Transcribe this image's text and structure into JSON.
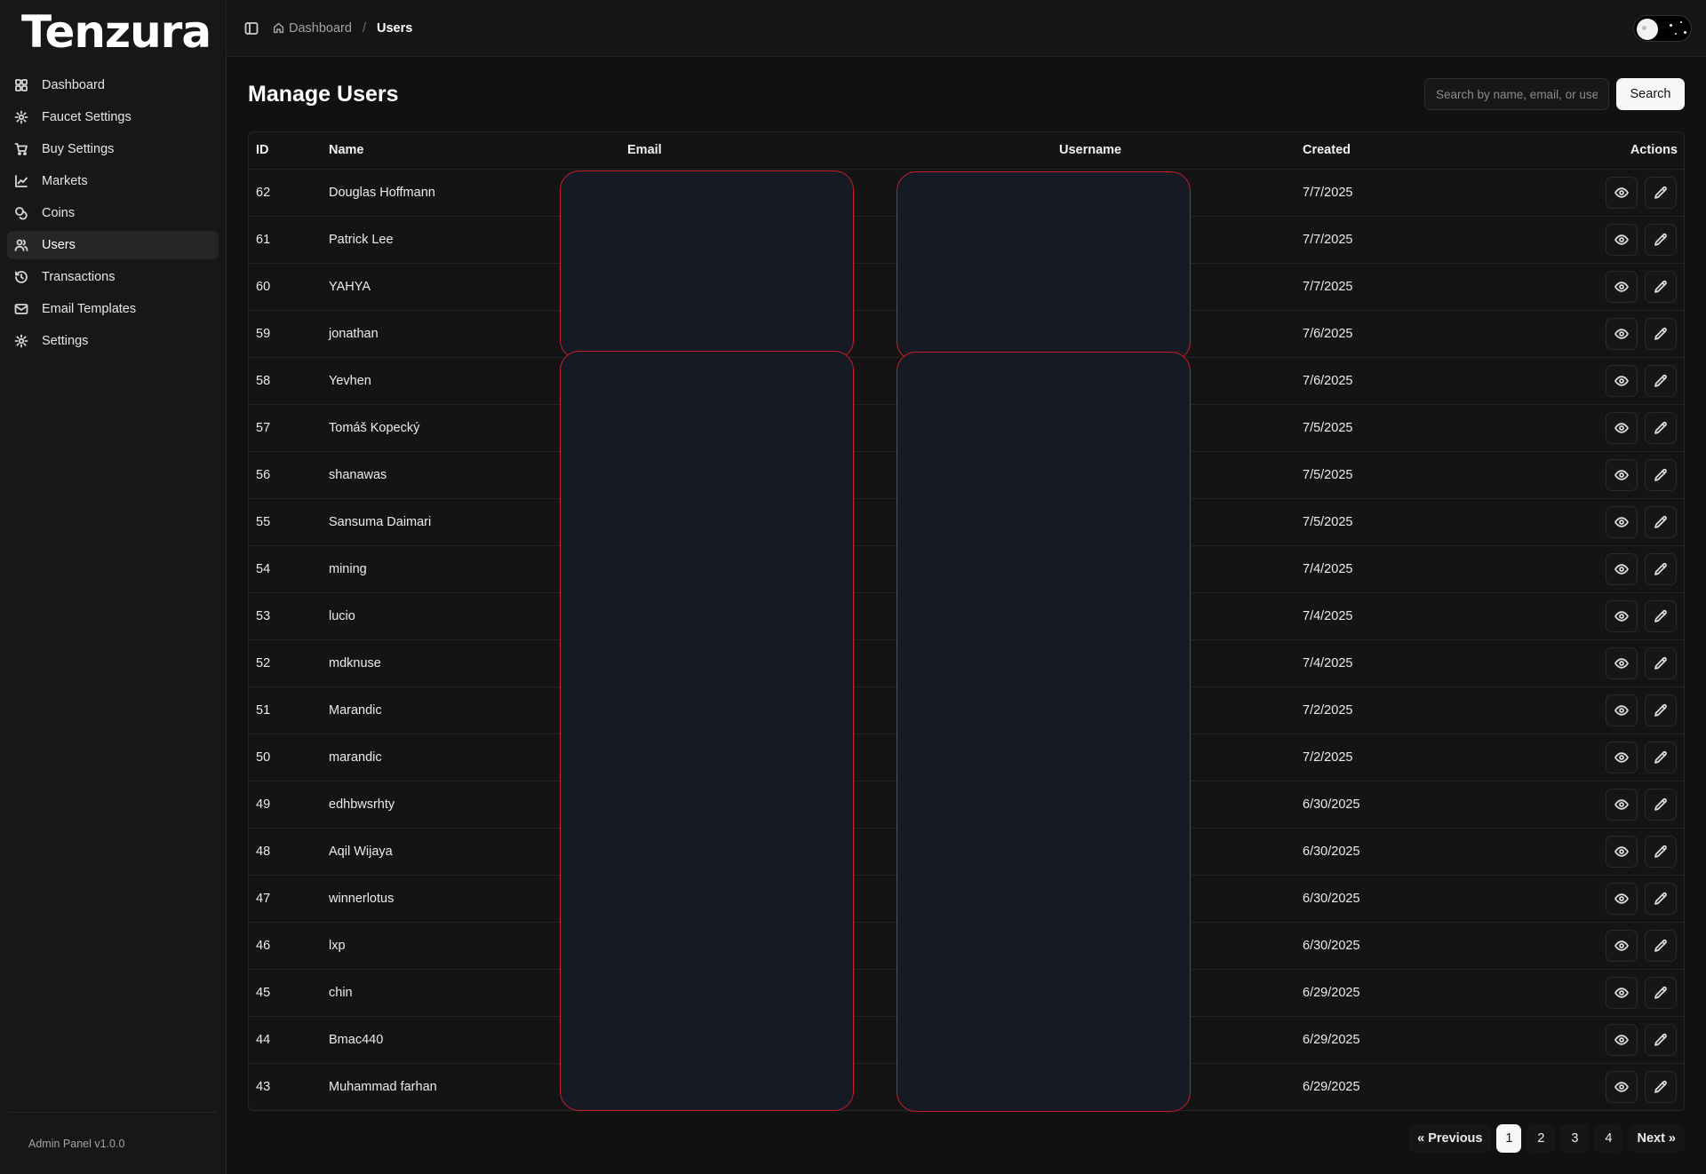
{
  "brand": {
    "name": "Tenzura"
  },
  "sidebar": {
    "items": [
      {
        "label": "Dashboard",
        "icon": "grid-icon",
        "active": false
      },
      {
        "label": "Faucet Settings",
        "icon": "gear-icon",
        "active": false
      },
      {
        "label": "Buy Settings",
        "icon": "cart-icon",
        "active": false
      },
      {
        "label": "Markets",
        "icon": "chart-line-icon",
        "active": false
      },
      {
        "label": "Coins",
        "icon": "coins-icon",
        "active": false
      },
      {
        "label": "Users",
        "icon": "users-icon",
        "active": true
      },
      {
        "label": "Transactions",
        "icon": "history-icon",
        "active": false
      },
      {
        "label": "Email Templates",
        "icon": "mail-icon",
        "active": false
      },
      {
        "label": "Settings",
        "icon": "gear-icon",
        "active": false
      }
    ],
    "footer": "Admin Panel v1.0.0"
  },
  "header": {
    "breadcrumb": {
      "home": "Dashboard",
      "separator": "/",
      "current": "Users"
    }
  },
  "page": {
    "title": "Manage Users",
    "search": {
      "placeholder": "Search by name, email, or username",
      "value": "",
      "button": "Search"
    }
  },
  "table": {
    "columns": [
      "ID",
      "Name",
      "Email",
      "Username",
      "Created",
      "Actions"
    ],
    "rows": [
      {
        "id": "62",
        "name": "Douglas Hoffmann",
        "created": "7/7/2025"
      },
      {
        "id": "61",
        "name": "Patrick Lee",
        "created": "7/7/2025"
      },
      {
        "id": "60",
        "name": "YAHYA",
        "created": "7/7/2025"
      },
      {
        "id": "59",
        "name": "jonathan",
        "created": "7/6/2025"
      },
      {
        "id": "58",
        "name": "Yevhen",
        "created": "7/6/2025"
      },
      {
        "id": "57",
        "name": "Tomáš Kopecký",
        "created": "7/5/2025"
      },
      {
        "id": "56",
        "name": "shanawas",
        "created": "7/5/2025"
      },
      {
        "id": "55",
        "name": "Sansuma Daimari",
        "created": "7/5/2025"
      },
      {
        "id": "54",
        "name": "mining",
        "created": "7/4/2025"
      },
      {
        "id": "53",
        "name": "lucio",
        "created": "7/4/2025"
      },
      {
        "id": "52",
        "name": "mdknuse",
        "created": "7/4/2025"
      },
      {
        "id": "51",
        "name": "Marandic",
        "created": "7/2/2025"
      },
      {
        "id": "50",
        "name": "marandic",
        "created": "7/2/2025"
      },
      {
        "id": "49",
        "name": "edhbwsrhty",
        "created": "6/30/2025"
      },
      {
        "id": "48",
        "name": "Aqil Wijaya",
        "created": "6/30/2025"
      },
      {
        "id": "47",
        "name": "winnerlotus",
        "created": "6/30/2025"
      },
      {
        "id": "46",
        "name": "lxp",
        "created": "6/30/2025"
      },
      {
        "id": "45",
        "name": "chin",
        "created": "6/29/2025"
      },
      {
        "id": "44",
        "name": "Bmac440",
        "created": "6/29/2025"
      },
      {
        "id": "43",
        "name": "Muhammad farhan",
        "created": "6/29/2025"
      }
    ],
    "row_actions": [
      "eye-icon",
      "pencil-icon"
    ]
  },
  "pagination": {
    "previous": "« Previous",
    "pages": [
      "1",
      "2",
      "3",
      "4"
    ],
    "current": "1",
    "next": "Next »"
  },
  "colors": {
    "background": "#111111",
    "sidebar": "#171717",
    "redaction_fill": "#161a24",
    "redaction_border": "#c81e2a",
    "primary_button": "#f7f7f7"
  }
}
